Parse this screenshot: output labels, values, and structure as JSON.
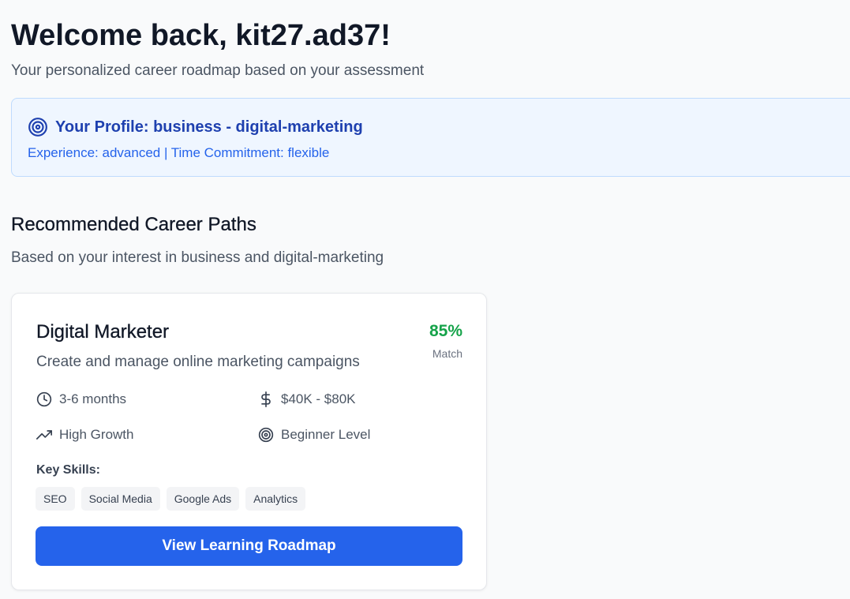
{
  "header": {
    "welcome": "Welcome back, kit27.ad37!",
    "subtitle": "Your personalized career roadmap based on your assessment"
  },
  "profile": {
    "title": "Your Profile: business - digital-marketing",
    "details": "Experience: advanced | Time Commitment: flexible",
    "icon": "target-icon"
  },
  "recommendations": {
    "title": "Recommended Career Paths",
    "subtitle": "Based on your interest in business and digital-marketing"
  },
  "career_card": {
    "title": "Digital Marketer",
    "description": "Create and manage online marketing campaigns",
    "match_value": "85%",
    "match_label": "Match",
    "duration": "3-6 months",
    "salary": "$40K - $80K",
    "growth": "High Growth",
    "level": "Beginner Level",
    "skills_label": "Key Skills:",
    "skills": [
      "SEO",
      "Social Media",
      "Google Ads",
      "Analytics"
    ],
    "cta_label": "View Learning Roadmap"
  },
  "colors": {
    "primary": "#2563eb",
    "match": "#16a34a",
    "profile_bg": "#eff6ff",
    "profile_text": "#1e40af"
  }
}
